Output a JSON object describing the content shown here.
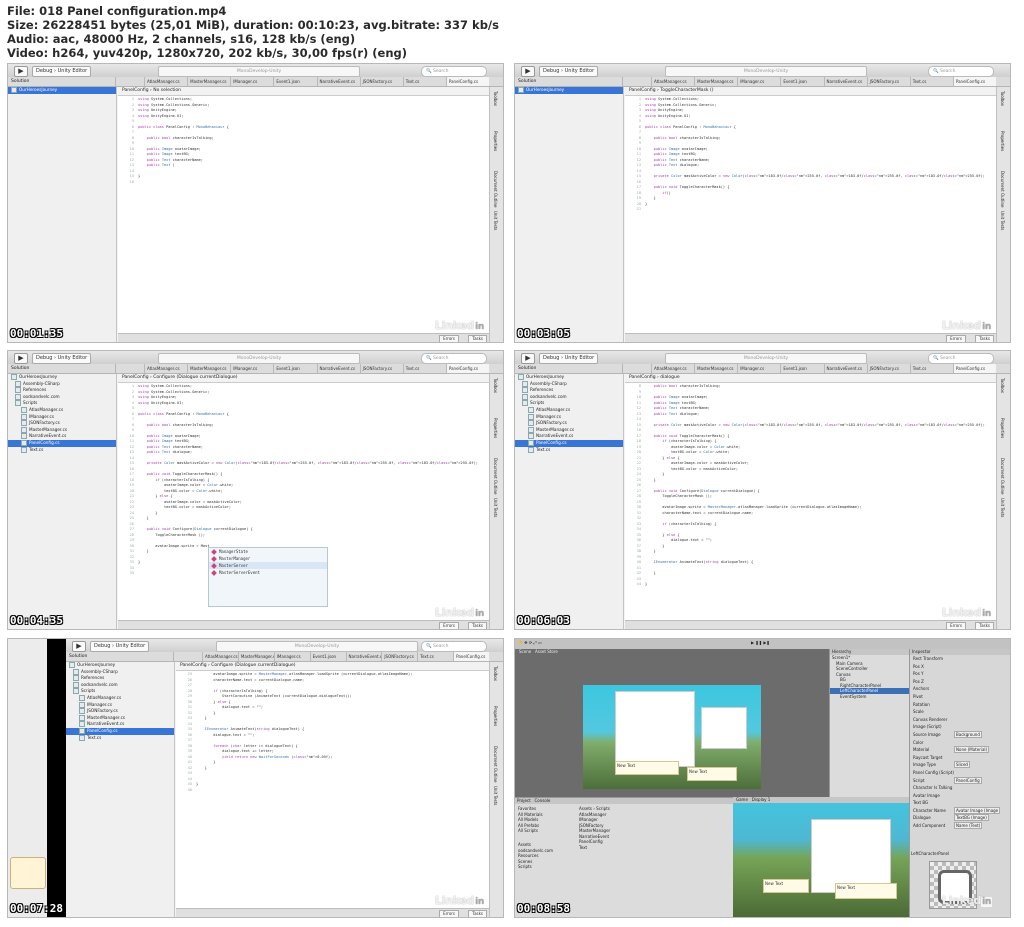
{
  "header": {
    "line1": "File: 018 Panel configuration.mp4",
    "line2": "Size: 26228451 bytes (25,01 MiB), duration: 00:10:23, avg.bitrate: 337 kb/s",
    "line3": "Audio: aac, 48000 Hz, 2 channels, s16, 128 kb/s (eng)",
    "line4": "Video: h264, yuv420p, 1280x720, 202 kb/s, 30,00 fps(r) (eng)"
  },
  "xcode": {
    "scheme": "Debug  ›  Unity Editor",
    "activity": "MonoDevelop-Unity",
    "search": "Search",
    "solution_label": "Solution",
    "tabs": [
      "AtlasManager.cs",
      "MasterManager.cs",
      "IManager.cs",
      "Event1.json",
      "NarrativeEvent.cs",
      "JSONFactory.cs",
      "Text.cs",
      "PanelConfig.cs"
    ],
    "right_panel": [
      "Toolbox",
      "Properties",
      "Document Outline",
      "Unit Tests"
    ],
    "status_errors": "Errors",
    "status_tasks": "Tasks",
    "watermark": "Linked"
  },
  "frames": [
    {
      "timestamp": "00:01:35",
      "breadcrumb": "PanelConfig  ›  No selection",
      "tree": [
        "OurHeroesJourney"
      ],
      "selected": 0,
      "code": [
        "using System.Collections;",
        "using System.Collections.Generic;",
        "using UnityEngine;",
        "using UnityEngine.UI;",
        "",
        "public class PanelConfig : MonoBehaviour {",
        "",
        "    public bool characterIsTalking;",
        "",
        "    public Image avatarImage;",
        "    public Image textBG;",
        "    public Text characterName;",
        "    public Text |",
        "",
        "}",
        ""
      ]
    },
    {
      "timestamp": "00:03:05",
      "breadcrumb": "PanelConfig  ›  ToggleCharacterMask ()",
      "tree": [
        "OurHeroesJourney"
      ],
      "selected": 0,
      "code": [
        "using System.Collections;",
        "using System.Collections.Generic;",
        "using UnityEngine;",
        "using UnityEngine.UI;",
        "",
        "public class PanelConfig : MonoBehaviour {",
        "",
        "    public bool characterIsTalking;",
        "",
        "    public Image avatarImage;",
        "    public Image textBG;",
        "    public Text characterName;",
        "    public Text dialogue;",
        "",
        "    private Color maskActiveColor = new Color(183.0f/255.0f, 183.0f/255.0f, 183.0f/255.0f);",
        "",
        "    public void ToggleCharacterMask() {",
        "        if(|",
        "    }",
        "}",
        ""
      ]
    },
    {
      "timestamp": "00:04:35",
      "breadcrumb": "PanelConfig  ›  Configure (Dialogue currentDialogue)",
      "tree": [
        "OurHeroesJourney",
        "Assembly-CSharp",
        "References",
        "oodsandvelc.com",
        "Scripts",
        "AtlasManager.cs",
        "IManager.cs",
        "JSONFactory.cs",
        "MasterManager.cs",
        "NarrativeEvent.cs",
        "PanelConfig.cs",
        "Text.cs"
      ],
      "selected": 10,
      "code": [
        "using System.Collections;",
        "using System.Collections.Generic;",
        "using UnityEngine;",
        "using UnityEngine.UI;",
        "",
        "public class PanelConfig : MonoBehaviour {",
        "",
        "    public bool characterIsTalking;",
        "",
        "    public Image avatarImage;",
        "    public Image textBG;",
        "    public Text characterName;",
        "    public Text dialogue;",
        "",
        "    private Color maskActiveColor = new Color(183.0f/255.0f, 183.0f/255.0f, 183.0f/255.0f);",
        "",
        "    public void ToggleCharacterMask() {",
        "        if (characterIsTalking) {",
        "            avatarImage.color = Color.white;",
        "            textBG.color = Color.white;",
        "        } else {",
        "            avatarImage.color = maskActiveColor;",
        "            textBG.color = maskActiveColor;",
        "        }",
        "    }",
        "",
        "    public void Configure(Dialogue currentDialogue) {",
        "        ToggleCharacterMask ();",
        "",
        "        avatarImage.sprite = Mast",
        "    }",
        "",
        "}",
        "",
        ""
      ],
      "autocomplete": [
        "ManagerState",
        "MasterManager",
        "MasterServer",
        "MasterServerEvent"
      ]
    },
    {
      "timestamp": "00:06:03",
      "breadcrumb": "PanelConfig  ›  dialogue",
      "tree": [
        "OurHeroesJourney",
        "Assembly-CSharp",
        "References",
        "oodsandvelc.com",
        "Scripts",
        "AtlasManager.cs",
        "IManager.cs",
        "JSONFactory.cs",
        "MasterManager.cs",
        "NarrativeEvent.cs",
        "PanelConfig.cs",
        "Text.cs"
      ],
      "selected": 10,
      "code": [
        "    public bool characterIsTalking;",
        "",
        "    public Image avatarImage;",
        "    public Image textBG;",
        "    public Text characterName;",
        "    public Text dialogue;",
        "",
        "    private Color maskActiveColor = new Color(183.0f/255.0f, 183.0f/255.0f, 183.0f/255.0f);",
        "",
        "    public void ToggleCharacterMask() {",
        "        if (characterIsTalking) {",
        "            avatarImage.color = Color.white;",
        "            textBG.color = Color.white;",
        "        } else {",
        "            avatarImage.color = maskActiveColor;",
        "            textBG.color = maskActiveColor;",
        "        }",
        "    }",
        "",
        "    public void Configure(Dialogue currentDialogue) {",
        "        ToggleCharacterMask ();",
        "",
        "        avatarImage.sprite = MasterManager.atlasManager.loadSprite (currentDialogue.atlasImageName);",
        "        characterName.text = currentDialogue.name;",
        "",
        "        if (characterIsTalking) {",
        "",
        "        } else {",
        "            dialogue.text = \"\";",
        "        }",
        "    }",
        "",
        "    IEnumerator AnimateText(string dialogueText) {",
        "",
        "    }",
        "",
        "}"
      ]
    },
    {
      "timestamp": "00:07:28",
      "breadcrumb": "PanelConfig  ›  Configure (Dialogue currentDialogue)",
      "tree": [
        "OurHeroesJourney",
        "Assembly-CSharp",
        "References",
        "oodsandvelc.com",
        "Scripts",
        "AtlasManager.cs",
        "IManager.cs",
        "JSONFactory.cs",
        "MasterManager.cs",
        "NarrativeEvent.cs",
        "PanelConfig.cs",
        "Text.cs"
      ],
      "selected": 10,
      "code": [
        "        avatarImage.sprite = MasterManager.atlasManager.loadSprite (currentDialogue.atlasImageName);",
        "        characterName.text = currentDialogue.name;",
        "",
        "        if (characterIsTalking) {",
        "            StartCoroutine (AnimateText (currentDialogue.dialogueText));",
        "        } else {",
        "            dialogue.text = \"\";",
        "        }",
        "    }",
        "",
        "    IEnumerator AnimateText(string dialogueText) {",
        "        dialogue.text = \"\";",
        "",
        "        foreach (char letter in dialogueText) {",
        "            dialogue.text += letter;",
        "            yield return new WaitForSeconds (0.05f);",
        "        }",
        "    }",
        "",
        "",
        "}",
        ""
      ]
    },
    {
      "timestamp": "00:08:58",
      "unity": {
        "tabs": [
          "Scene",
          "Asset Store"
        ],
        "hierarchy_title": "Hierarchy",
        "hierarchy": [
          "Screen1*",
          "Main Camera",
          "SceneController",
          "Canvas",
          "BG",
          "RightCharacterPanel",
          "LeftCharacterPanel",
          "EventSystem"
        ],
        "inspector_title": "Inspector",
        "inspector": [
          "Rect Transform",
          "Pos X",
          "Pos Y",
          "Pos Z",
          "Anchors",
          "Pivot",
          "Rotation",
          "Scale",
          "Canvas Renderer",
          "Image (Script)",
          "Source Image",
          "Color",
          "Material",
          "Raycast Target",
          "Image Type",
          "Panel Config (Script)",
          "Script",
          "Character Is Talking",
          "Avatar Image",
          "Text BG",
          "Character Name",
          "Dialogue",
          "Add Component"
        ],
        "inspector_values": [
          "Background",
          "None (Material)",
          "Sliced",
          "PanelConfig",
          "Avatar Image (Image",
          "TextBG (Image)",
          "Name (Text)",
          "DialogueText (Text)"
        ],
        "project_tabs": [
          "Project",
          "Console"
        ],
        "favorites": [
          "Favorites",
          "All Materials",
          "All Models",
          "All Prefabs",
          "All Scripts"
        ],
        "assets": [
          "Assets",
          "oodsandvelc.com",
          "Resources",
          "Scenes",
          "Scripts"
        ],
        "scripts_path": "Assets  ›  Scripts",
        "scripts": [
          "AtlasManager",
          "IManager",
          "JSONFactory",
          "MasterManager",
          "NarrativeEvent",
          "PanelConfig",
          "Text"
        ],
        "game_tab": "Game",
        "display": "Display 1",
        "new_text": "New Text",
        "bottom_label": "LeftCharacterPanel"
      }
    }
  ]
}
